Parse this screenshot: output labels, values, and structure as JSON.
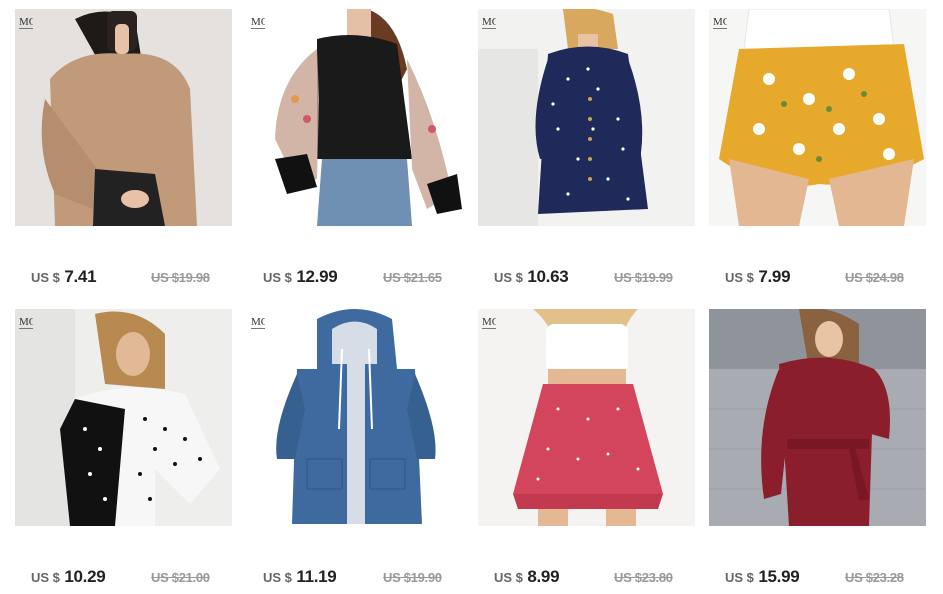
{
  "products": [
    {
      "currency": "US $",
      "price": "7.41",
      "original": "US $19.98",
      "brand": true,
      "colors": {
        "bg": "#e5e1de",
        "main": "#c19a7a",
        "accent": "#2a2220",
        "skin": "#e7c2a7"
      }
    },
    {
      "currency": "US $",
      "price": "12.99",
      "original": "US $21.65",
      "brand": true,
      "colors": {
        "bg": "#ffffff",
        "main": "#1a1a1a",
        "accent": "#6f8fb3",
        "skin": "#e4c1a6"
      }
    },
    {
      "currency": "US $",
      "price": "10.63",
      "original": "US $19.99",
      "brand": true,
      "colors": {
        "bg": "#f2f2f0",
        "main": "#1f2a5a",
        "accent": "#ffffff",
        "skin": "#e8c3a3"
      }
    },
    {
      "currency": "US $",
      "price": "7.99",
      "original": "US $24.98",
      "brand": true,
      "colors": {
        "bg": "#f6f6f4",
        "main": "#e7a92c",
        "accent": "#ffffff",
        "skin": "#e3b792"
      }
    },
    {
      "currency": "US $",
      "price": "10.29",
      "original": "US $21.00",
      "brand": true,
      "colors": {
        "bg": "#eeeeec",
        "main": "#f7f7f7",
        "accent": "#111111",
        "skin": "#e1b996"
      }
    },
    {
      "currency": "US $",
      "price": "11.19",
      "original": "US $19.90",
      "brand": true,
      "colors": {
        "bg": "#ffffff",
        "main": "#3e6aa0",
        "accent": "#d7dde6",
        "skin": "#e4c1a6"
      }
    },
    {
      "currency": "US $",
      "price": "8.99",
      "original": "US $23.80",
      "brand": true,
      "colors": {
        "bg": "#f4f3f1",
        "main": "#d2455a",
        "accent": "#ffffff",
        "skin": "#e3b893"
      }
    },
    {
      "currency": "US $",
      "price": "15.99",
      "original": "US $23.28",
      "brand": false,
      "colors": {
        "bg": "#b8bcc3",
        "main": "#8b1e2c",
        "accent": "#6c6f76",
        "skin": "#e8c4a5"
      }
    }
  ]
}
